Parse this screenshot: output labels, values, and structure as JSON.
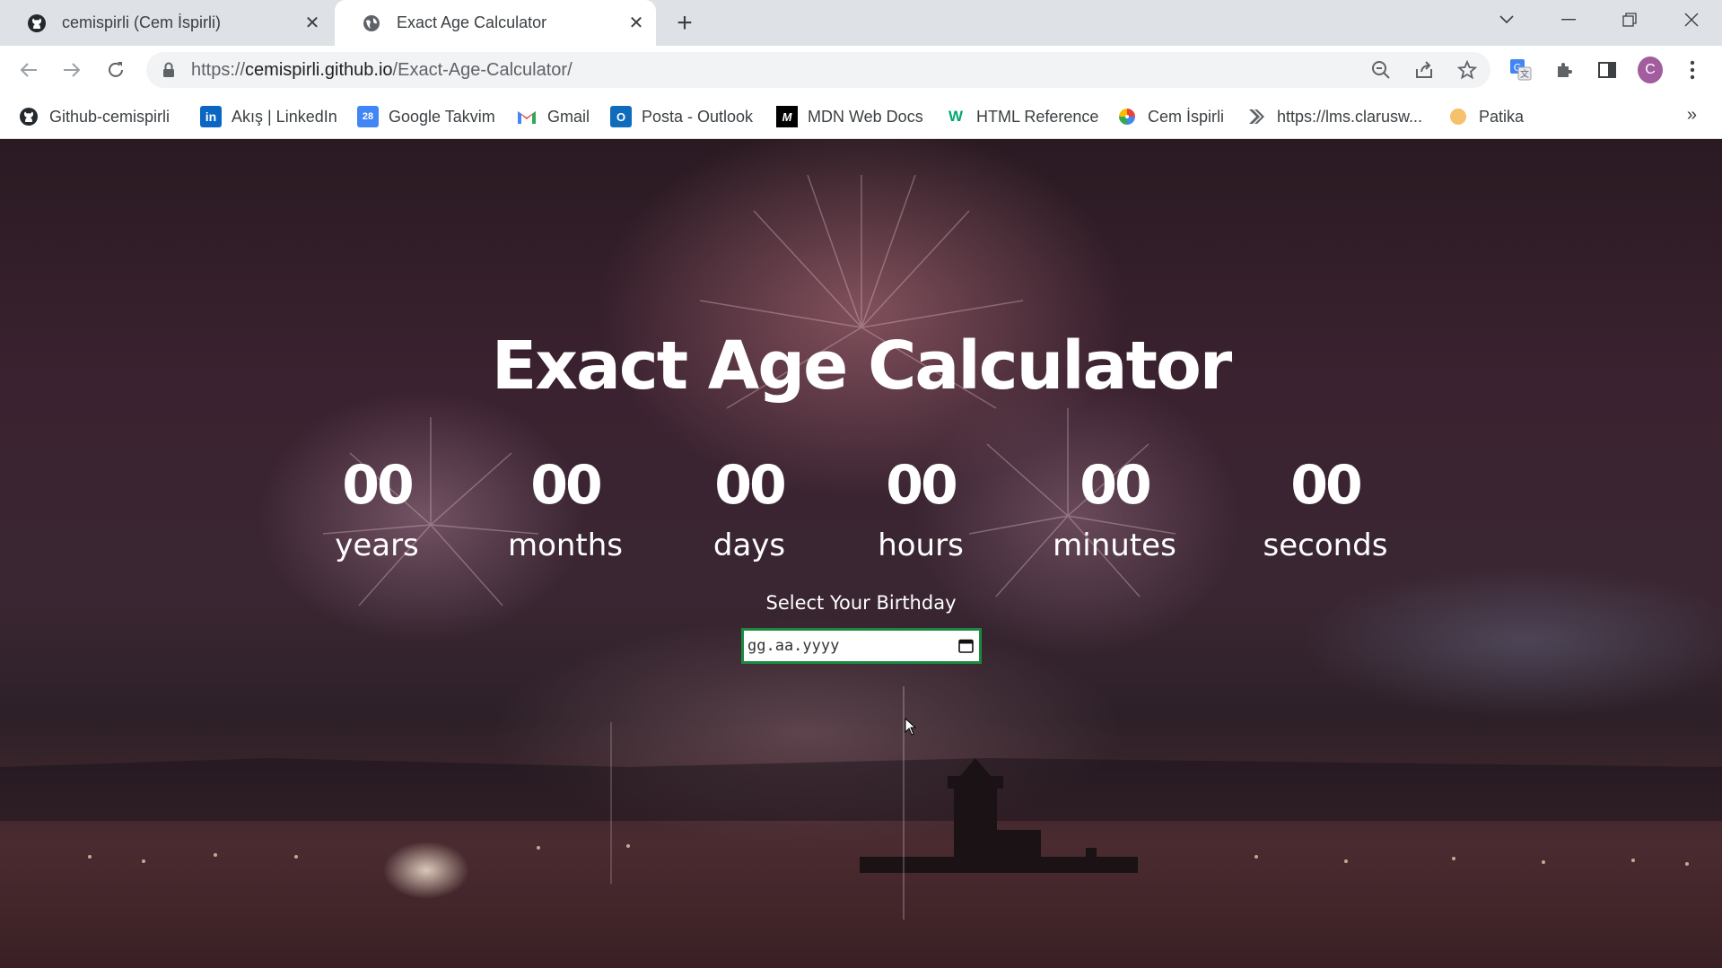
{
  "browser": {
    "tabs": [
      {
        "title": "cemispirli (Cem İspirli)",
        "active": false,
        "favicon": "github-icon"
      },
      {
        "title": "Exact Age Calculator",
        "active": true,
        "favicon": "globe-icon"
      }
    ],
    "address": {
      "url_prefix": "https://",
      "url_host": "cemispirli.github.io",
      "url_path": "/Exact-Age-Calculator/"
    },
    "profile_initial": "C",
    "bookmarks": [
      {
        "label": "Github-cemispirli",
        "icon": "github-icon"
      },
      {
        "label": "Akış | LinkedIn",
        "icon": "linkedin-icon"
      },
      {
        "label": "Google Takvim",
        "icon": "calendar-icon"
      },
      {
        "label": "Gmail",
        "icon": "gmail-icon"
      },
      {
        "label": "Posta - Outlook",
        "icon": "outlook-icon"
      },
      {
        "label": "MDN Web Docs",
        "icon": "mdn-icon"
      },
      {
        "label": "HTML Reference",
        "icon": "w3-icon"
      },
      {
        "label": "Cem İspirli",
        "icon": "swirl-icon"
      },
      {
        "label": "https://lms.clarusw...",
        "icon": "clarusway-icon"
      },
      {
        "label": "Patika",
        "icon": "patika-icon"
      }
    ],
    "bookmarks_more": "»"
  },
  "app": {
    "title": "Exact Age Calculator",
    "counters": [
      {
        "value": "00",
        "label": "years"
      },
      {
        "value": "00",
        "label": "months"
      },
      {
        "value": "00",
        "label": "days"
      },
      {
        "value": "00",
        "label": "hours"
      },
      {
        "value": "00",
        "label": "minutes"
      },
      {
        "value": "00",
        "label": "seconds"
      }
    ],
    "birthday_label": "Select Your Birthday",
    "date_placeholder": "gg.aa.yyyy"
  }
}
